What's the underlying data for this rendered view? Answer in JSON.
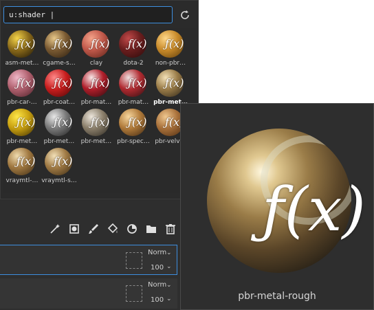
{
  "search": {
    "value": "u:shader |",
    "placeholder": ""
  },
  "shelf": {
    "items": [
      {
        "label": "asm-met…",
        "colors": [
          "#f5d54a",
          "#8a6a1a",
          "#1a1306"
        ]
      },
      {
        "label": "cgame-s…",
        "colors": [
          "#e8c88a",
          "#7a5a32",
          "#2a1e10"
        ]
      },
      {
        "label": "clay",
        "colors": [
          "#f4a38a",
          "#c0584a",
          "#5a2218"
        ]
      },
      {
        "label": "dota-2",
        "colors": [
          "#c24a4a",
          "#6a1e1e",
          "#2a0a0a"
        ]
      },
      {
        "label": "non-pbr…",
        "colors": [
          "#ffd88a",
          "#c88a2a",
          "#5a3a0a"
        ]
      },
      {
        "label": "pbr-car-…",
        "colors": [
          "#f0b8c8",
          "#b0606e",
          "#4a2028"
        ]
      },
      {
        "label": "pbr-coat…",
        "colors": [
          "#ff8a8a",
          "#c81e1e",
          "#4a0606"
        ]
      },
      {
        "label": "pbr-mat…",
        "colors": [
          "#f8e8e8",
          "#b01e2a",
          "#2a0a0e"
        ]
      },
      {
        "label": "pbr-mat…",
        "colors": [
          "#f0e0e0",
          "#b02a30",
          "#2a0e10"
        ]
      },
      {
        "label": "pbr-met…",
        "colors": [
          "#f4e2b8",
          "#9a7c48",
          "#2c2418"
        ]
      },
      {
        "label": "pbr-met…",
        "colors": [
          "#ffe84a",
          "#c8a010",
          "#3a2a04"
        ]
      },
      {
        "label": "pbr-met…",
        "colors": [
          "#e8e8e8",
          "#7a7a7a",
          "#1e1e1e"
        ]
      },
      {
        "label": "pbr-met…",
        "colors": [
          "#ece6dc",
          "#8a7e6a",
          "#2a2620"
        ]
      },
      {
        "label": "pbr-spec…",
        "colors": [
          "#f8d8a0",
          "#b07a3a",
          "#3a2410"
        ]
      },
      {
        "label": "pbr-velvet",
        "colors": [
          "#f0c890",
          "#a8703a",
          "#4a2a10"
        ]
      },
      {
        "label": "vraymtl-…",
        "colors": [
          "#f0dcb0",
          "#a07840",
          "#3a2a14"
        ]
      },
      {
        "label": "vraymtl-s…",
        "colors": [
          "#f2e0b8",
          "#a07a44",
          "#3a2a14"
        ]
      }
    ],
    "selected_index": 9
  },
  "preview": {
    "label": "pbr-metal-rough",
    "fx_glyph": "ƒ(x)"
  },
  "layers": {
    "rows": [
      {
        "blend": "Norm",
        "opacity": "100"
      },
      {
        "blend": "Norm",
        "opacity": "100"
      }
    ]
  },
  "colors": {
    "accent": "#3d8fe0",
    "panel": "#2e2e2e"
  }
}
